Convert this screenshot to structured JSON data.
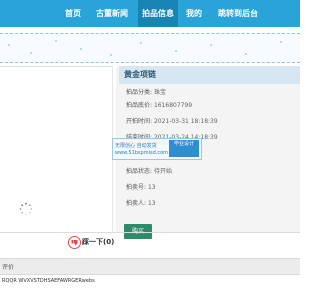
{
  "nav": {
    "items": [
      {
        "label": "首页"
      },
      {
        "label": "古董新闻"
      },
      {
        "label": "拍品信息",
        "active": true
      },
      {
        "label": "我的"
      },
      {
        "label": "跳转到后台"
      }
    ]
  },
  "item": {
    "title": "黄金项链",
    "rows": [
      {
        "label": "拍品分类:",
        "value": "珠宝"
      },
      {
        "label": "拍品底价:",
        "value": "1616807799"
      },
      {
        "label": "开拍时间:",
        "value": "2021-03-31 18:18:39"
      },
      {
        "label": "结束时间:",
        "value": "2021-03-24 14:18:39"
      },
      {
        "label": "拍品状态:",
        "value": "待开始"
      },
      {
        "label": "拍卖号:",
        "value": "13"
      },
      {
        "label": "拍卖人:",
        "value": "13"
      }
    ],
    "buy_label": "购买"
  },
  "watermark": {
    "line1": "无限创心 自动发货",
    "line2": "www.51bspmisd.com",
    "badge": "毕业设计"
  },
  "next": {
    "label": "踩一下(0)",
    "icon": "thumbs-down-icon"
  },
  "reviews": {
    "label": "评价",
    "text": "RQQR WVXVSTDHSAEFAWRGERwebs"
  },
  "colors": {
    "nav_bg": "#2aa4d8",
    "nav_active": "#1884b3",
    "title_bg": "#d6e7f2",
    "buy_button": "#2d8a6b"
  }
}
